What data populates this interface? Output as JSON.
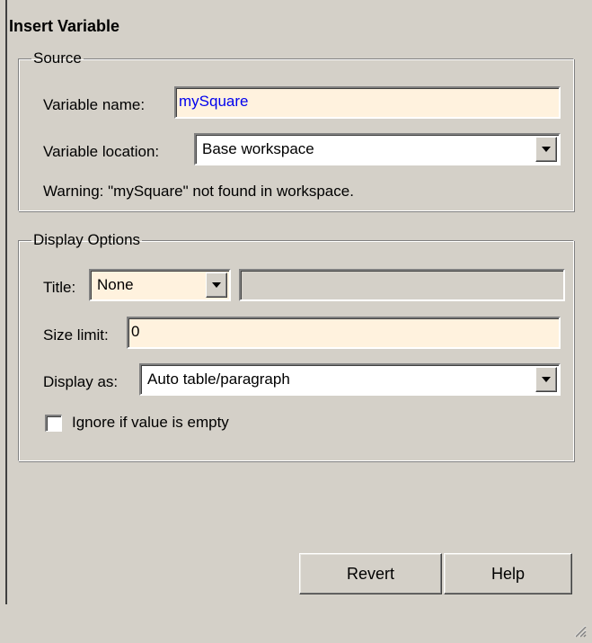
{
  "panel": {
    "title": "Insert Variable"
  },
  "source": {
    "legend": "Source",
    "variable_name_label": "Variable name:",
    "variable_name_value": "mySquare",
    "variable_location_label": "Variable location:",
    "variable_location_value": "Base workspace",
    "warning": "Warning: \"mySquare\" not found in workspace."
  },
  "display_options": {
    "legend": "Display Options",
    "title_label": "Title:",
    "title_value": "None",
    "custom_title_value": "",
    "size_limit_label": "Size limit:",
    "size_limit_value": "0",
    "display_as_label": "Display as:",
    "display_as_value": "Auto table/paragraph",
    "ignore_empty_label": "Ignore if value is empty",
    "ignore_empty_checked": false
  },
  "buttons": {
    "revert": "Revert",
    "help": "Help"
  },
  "colors": {
    "background": "#d4d0c8",
    "field_bg": "#fff2de",
    "variable_name_text": "#0000ee"
  }
}
